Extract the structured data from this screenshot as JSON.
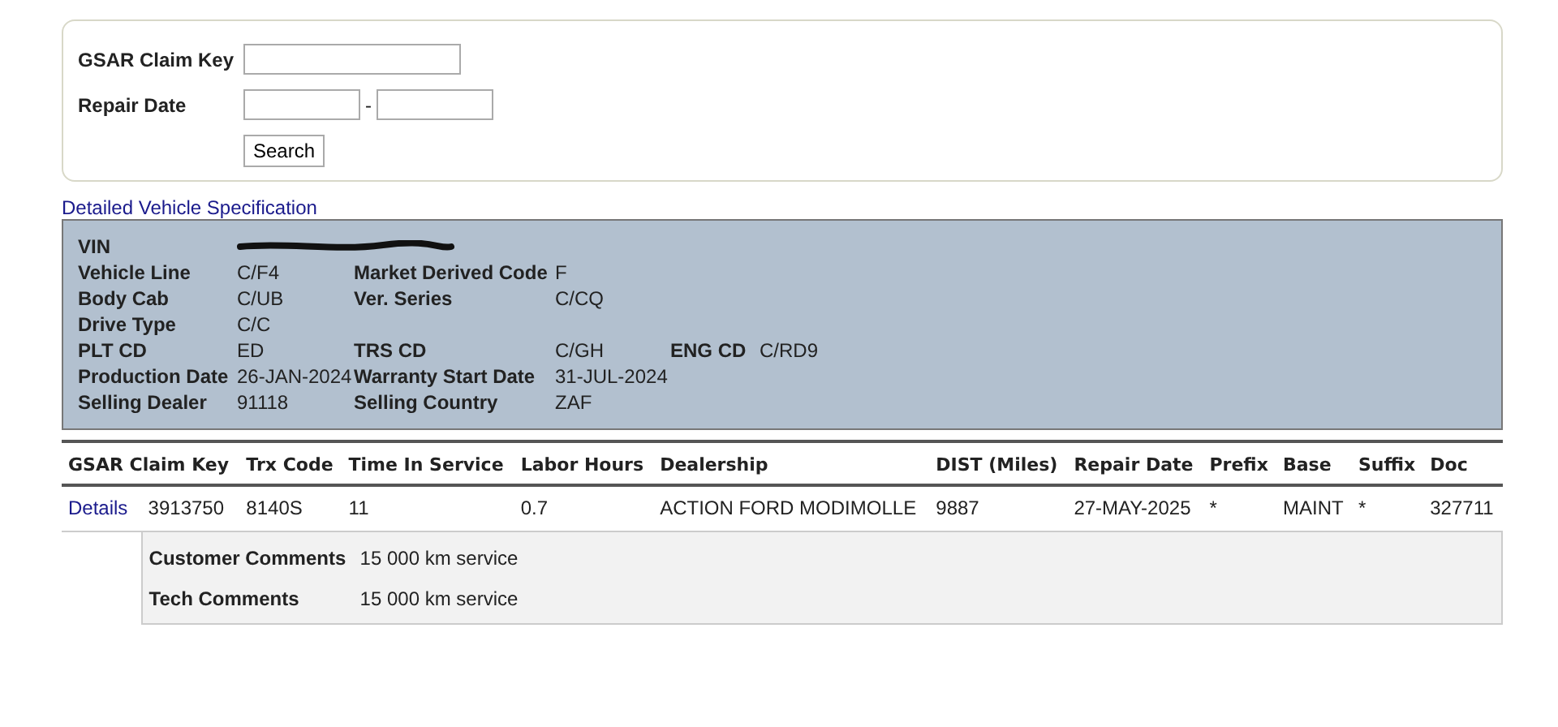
{
  "search_form": {
    "fields": [
      {
        "label": "GSAR Claim Key",
        "kind": "single"
      },
      {
        "label": "Repair Date",
        "kind": "range",
        "separator": "-"
      }
    ],
    "button": "Search"
  },
  "spec_link": "Detailed Vehicle Specification",
  "spec": {
    "rows": [
      [
        {
          "label": "VIN",
          "redacted": true
        }
      ],
      [
        {
          "label": "Vehicle Line",
          "value": "C/F4"
        },
        {
          "label": "Market Derived Code",
          "value": "F"
        }
      ],
      [
        {
          "label": "Body Cab",
          "value": "C/UB"
        },
        {
          "label": "Ver. Series",
          "value": "C/CQ"
        }
      ],
      [
        {
          "label": "Drive Type",
          "value": "C/C"
        }
      ],
      [
        {
          "label": "PLT CD",
          "value": "ED"
        },
        {
          "label": "TRS CD",
          "value": "C/GH"
        },
        {
          "label": "ENG CD",
          "value": "C/RD9"
        }
      ],
      [
        {
          "label": "Production Date",
          "value": "26-JAN-2024"
        },
        {
          "label": "Warranty Start Date",
          "value": "31-JUL-2024"
        }
      ],
      [
        {
          "label": "Selling Dealer",
          "value": "91118"
        },
        {
          "label": "Selling Country",
          "value": "ZAF"
        }
      ]
    ]
  },
  "table": {
    "columns": [
      "GSAR Claim Key",
      "Trx Code",
      "Time In Service",
      "Labor Hours",
      "Dealership",
      "DIST (Miles)",
      "Repair Date",
      "Prefix",
      "Base",
      "Suffix",
      "Doc"
    ],
    "rows": [
      {
        "link": "Details",
        "cells": [
          "3913750",
          "8140S",
          "11",
          "0.7",
          "ACTION FORD MODIMOLLE",
          "9887",
          "27-MAY-2025",
          "*",
          "MAINT",
          "*",
          "327711"
        ],
        "comments": [
          {
            "label": "Customer Comments",
            "value": "15 000 km service"
          },
          {
            "label": "Tech Comments",
            "value": "15 000 km service"
          }
        ]
      }
    ]
  }
}
